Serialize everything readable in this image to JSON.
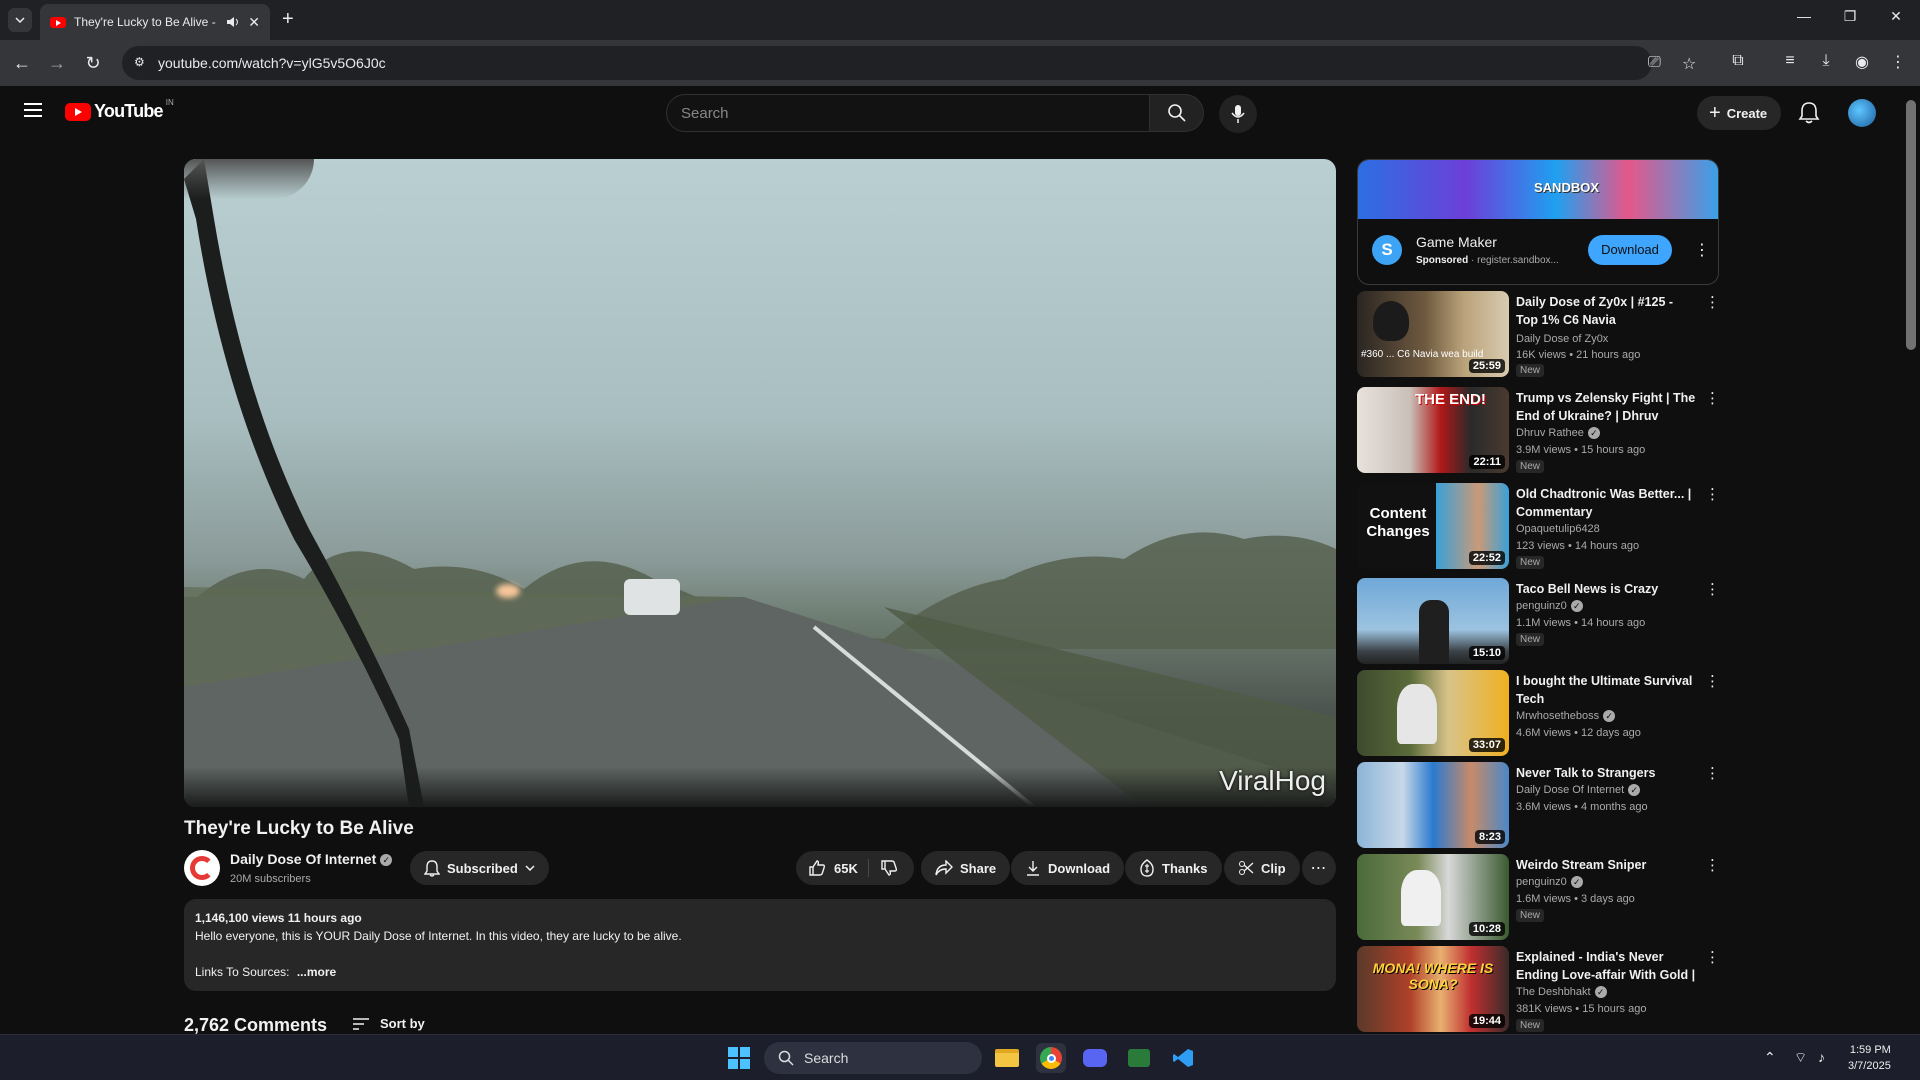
{
  "browser": {
    "tab_title": "They're Lucky to Be Alive - YouTube",
    "url": "youtube.com/watch?v=ylG5v5O6J0c",
    "new_tab": "+"
  },
  "header": {
    "logo_text": "YouTube",
    "country_code": "IN",
    "search_placeholder": "Search",
    "create_label": "Create"
  },
  "video": {
    "watermark": "ViralHog",
    "title": "They're Lucky to Be Alive",
    "channel": "Daily Dose Of Internet",
    "subscribers": "20M subscribers",
    "subscribed_label": "Subscribed",
    "likes": "65K",
    "share_label": "Share",
    "download_label": "Download",
    "thanks_label": "Thanks",
    "clip_label": "Clip",
    "stats": "1,146,100 views  11 hours ago",
    "description": "Hello everyone, this is YOUR Daily Dose of Internet. In this video, they are lucky to be alive.",
    "links": "Links To Sources:",
    "more": "...more",
    "comments_count": "2,762 Comments",
    "sort_by": "Sort by"
  },
  "ad": {
    "banner_text": "SANDBOX",
    "logo_letter": "S",
    "title": "Game Maker",
    "sponsored": "Sponsored",
    "domain": "register.sandbox...",
    "cta": "Download"
  },
  "recommendations": [
    {
      "title": "Daily Dose of Zy0x | #125 - Top 1% C6 Navia",
      "channel": "Daily Dose of Zy0x",
      "verified": false,
      "meta": "16K views  •  21 hours ago",
      "badge": "New",
      "duration": "25:59",
      "thumb_text": "#360 ... C6 Navia wea build"
    },
    {
      "title": "Trump vs Zelensky Fight | The End of Ukraine? | Dhruv Rathee",
      "channel": "Dhruv Rathee",
      "verified": true,
      "meta": "3.9M views  •  15 hours ago",
      "badge": "New",
      "duration": "22:11",
      "thumb_text": "THE END!"
    },
    {
      "title": "Old Chadtronic Was Better... | Commentary",
      "channel": "Opaquetulip6428",
      "verified": false,
      "meta": "123 views  •  14 hours ago",
      "badge": "New",
      "duration": "22:52",
      "thumb_text": "Content Changes"
    },
    {
      "title": "Taco Bell News is Crazy",
      "channel": "penguinz0",
      "verified": true,
      "meta": "1.1M views  •  14 hours ago",
      "badge": "New",
      "duration": "15:10",
      "thumb_text": ""
    },
    {
      "title": "I bought the Ultimate Survival Tech",
      "channel": "Mrwhosetheboss",
      "verified": true,
      "meta": "4.6M views  •  12 days ago",
      "badge": "",
      "duration": "33:07",
      "thumb_text": ""
    },
    {
      "title": "Never Talk to Strangers",
      "channel": "Daily Dose Of Internet",
      "verified": true,
      "meta": "3.6M views  •  4 months ago",
      "badge": "",
      "duration": "8:23",
      "thumb_text": ""
    },
    {
      "title": "Weirdo Stream Sniper",
      "channel": "penguinz0",
      "verified": true,
      "meta": "1.6M views  •  3 days ago",
      "badge": "New",
      "duration": "10:28",
      "thumb_text": ""
    },
    {
      "title": "Explained - India's Never Ending Love-affair With Gold | Ranya...",
      "channel": "The Deshbhakt",
      "verified": true,
      "meta": "381K views  •  15 hours ago",
      "badge": "New",
      "duration": "19:44",
      "thumb_text": "MONA! WHERE IS SONA?"
    }
  ],
  "taskbar": {
    "search_label": "Search",
    "time": "1:59 PM",
    "date": "3/7/2025"
  },
  "colors": {
    "background": "#0f0f0f",
    "surface": "#272727",
    "accent_blue": "#3ea6ff",
    "brand_red": "#ff0000"
  }
}
